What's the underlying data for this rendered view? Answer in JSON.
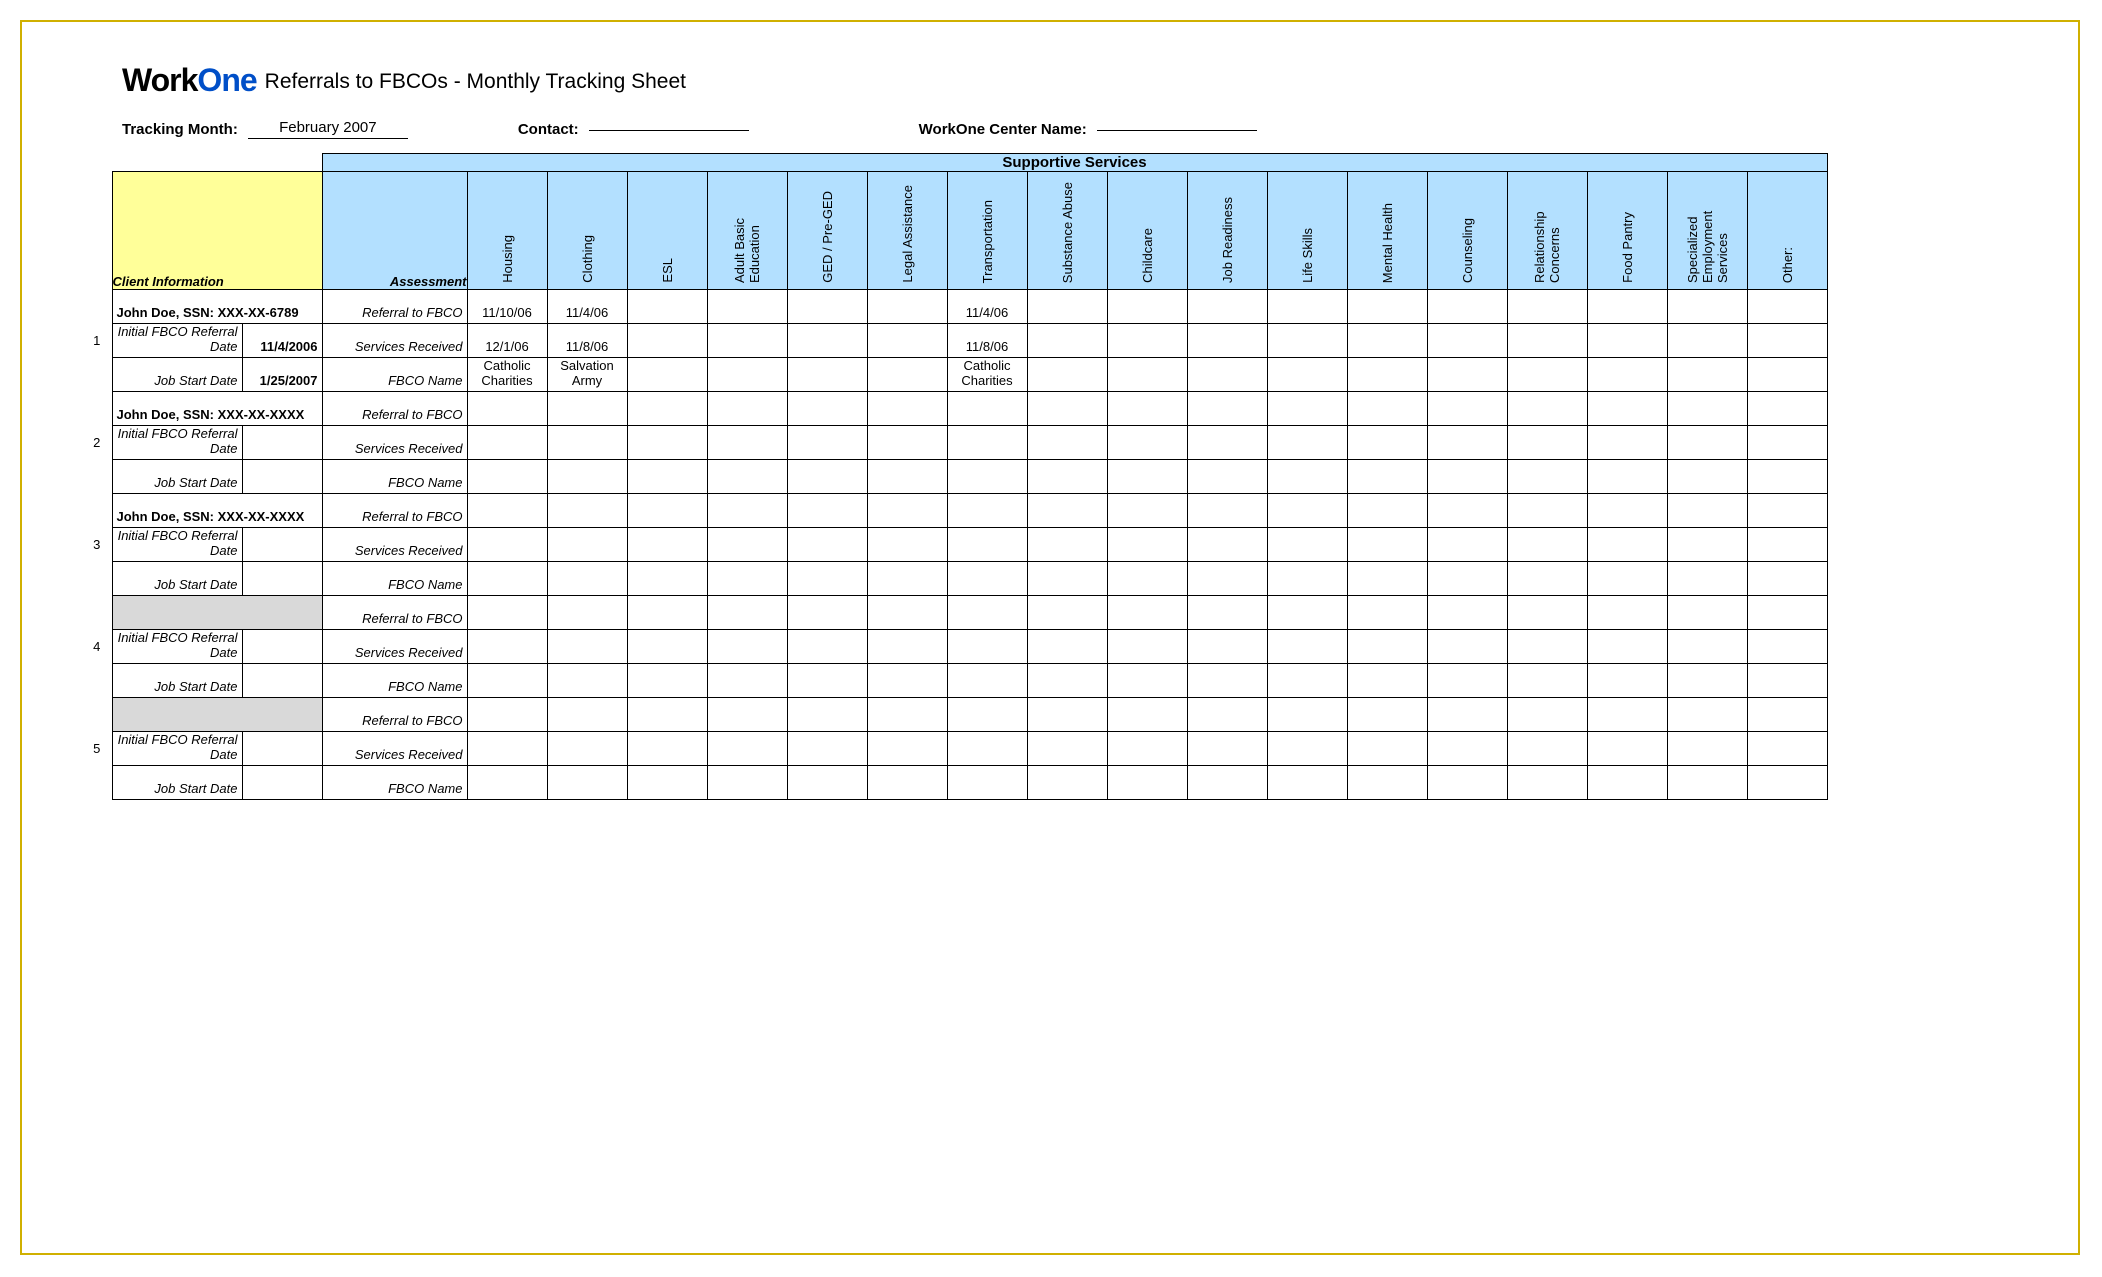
{
  "title": "Referrals to FBCOs - Monthly Tracking Sheet",
  "logo": {
    "part1": "Work",
    "part2": "One"
  },
  "meta": {
    "tracking_month_label": "Tracking Month:",
    "tracking_month_value": "February 2007",
    "contact_label": "Contact:",
    "contact_value": "",
    "center_label": "WorkOne Center Name:",
    "center_value": ""
  },
  "headers": {
    "super": "Supportive Services",
    "client_info": "Client Information",
    "assessment": "Assessment",
    "services": [
      "Housing",
      "Clothing",
      "ESL",
      "Adult Basic Education",
      "GED / Pre-GED",
      "Legal Assistance",
      "Transportation",
      "Substance Abuse",
      "Childcare",
      "Job Readiness",
      "Life Skills",
      "Mental Health",
      "Counseling",
      "Relationship Concerns",
      "Food Pantry",
      "Specialized Employment Services",
      "Other:"
    ]
  },
  "row_sublabels": {
    "referral": "Referral to FBCO",
    "services": "Services Received",
    "fbco_name": "FBCO Name",
    "initial": "Initial FBCO Referral Date",
    "jobstart": "Job Start Date"
  },
  "clients": [
    {
      "num": "1",
      "name": "John Doe, SSN: XXX-XX-6789",
      "initial_date": "11/4/2006",
      "jobstart_date": "1/25/2007",
      "rows": {
        "referral": {
          "Housing": "11/10/06",
          "Clothing": "11/4/06",
          "Transportation": "11/4/06"
        },
        "services": {
          "Housing": "12/1/06",
          "Clothing": "11/8/06",
          "Transportation": "11/8/06"
        },
        "fbco_name": {
          "Housing": "Catholic Charities",
          "Clothing": "Salvation Army",
          "Transportation": "Catholic Charities"
        }
      }
    },
    {
      "num": "2",
      "name": "John Doe, SSN: XXX-XX-XXXX",
      "initial_date": "",
      "jobstart_date": "",
      "rows": {
        "referral": {},
        "services": {},
        "fbco_name": {}
      }
    },
    {
      "num": "3",
      "name": "John Doe, SSN: XXX-XX-XXXX",
      "initial_date": "",
      "jobstart_date": "",
      "rows": {
        "referral": {},
        "services": {},
        "fbco_name": {}
      }
    },
    {
      "num": "4",
      "name": "",
      "initial_date": "",
      "jobstart_date": "",
      "rows": {
        "referral": {},
        "services": {},
        "fbco_name": {}
      }
    },
    {
      "num": "5",
      "name": "",
      "initial_date": "",
      "jobstart_date": "",
      "rows": {
        "referral": {},
        "services": {},
        "fbco_name": {}
      }
    }
  ]
}
